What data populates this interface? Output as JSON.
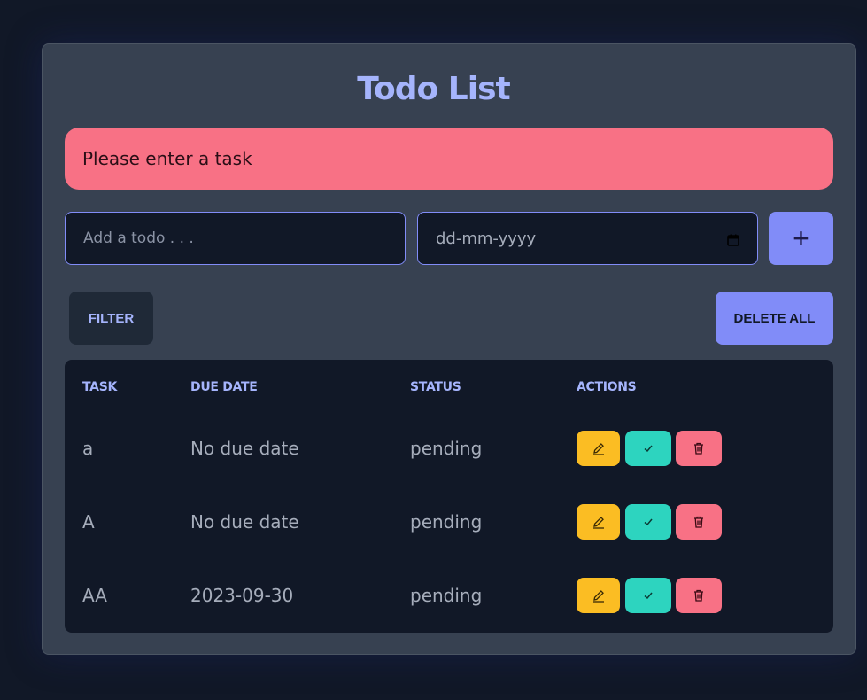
{
  "app": {
    "title": "Todo List"
  },
  "alert": {
    "message": "Please enter a task"
  },
  "form": {
    "task_placeholder": "Add a todo . . .",
    "date_placeholder": "dd-mm-yyyy",
    "add_label": "+"
  },
  "toolbar": {
    "filter_label": "FILTER",
    "delete_all_label": "DELETE ALL"
  },
  "table": {
    "headers": [
      "TASK",
      "DUE DATE",
      "STATUS",
      "ACTIONS"
    ],
    "rows": [
      {
        "task": "a",
        "due_date": "No due date",
        "status": "pending"
      },
      {
        "task": "A",
        "due_date": "No due date",
        "status": "pending"
      },
      {
        "task": "AA",
        "due_date": "2023-09-30",
        "status": "pending"
      }
    ]
  },
  "colors": {
    "background": "#111827",
    "card": "#374151",
    "accent": "#818cf8",
    "alert": "#f87185",
    "edit": "#fbbd23",
    "complete": "#2dd4bf",
    "delete": "#f87185"
  },
  "icons": {
    "edit": "pencil-icon",
    "complete": "check-icon",
    "delete": "trash-icon",
    "date": "calendar-icon"
  }
}
